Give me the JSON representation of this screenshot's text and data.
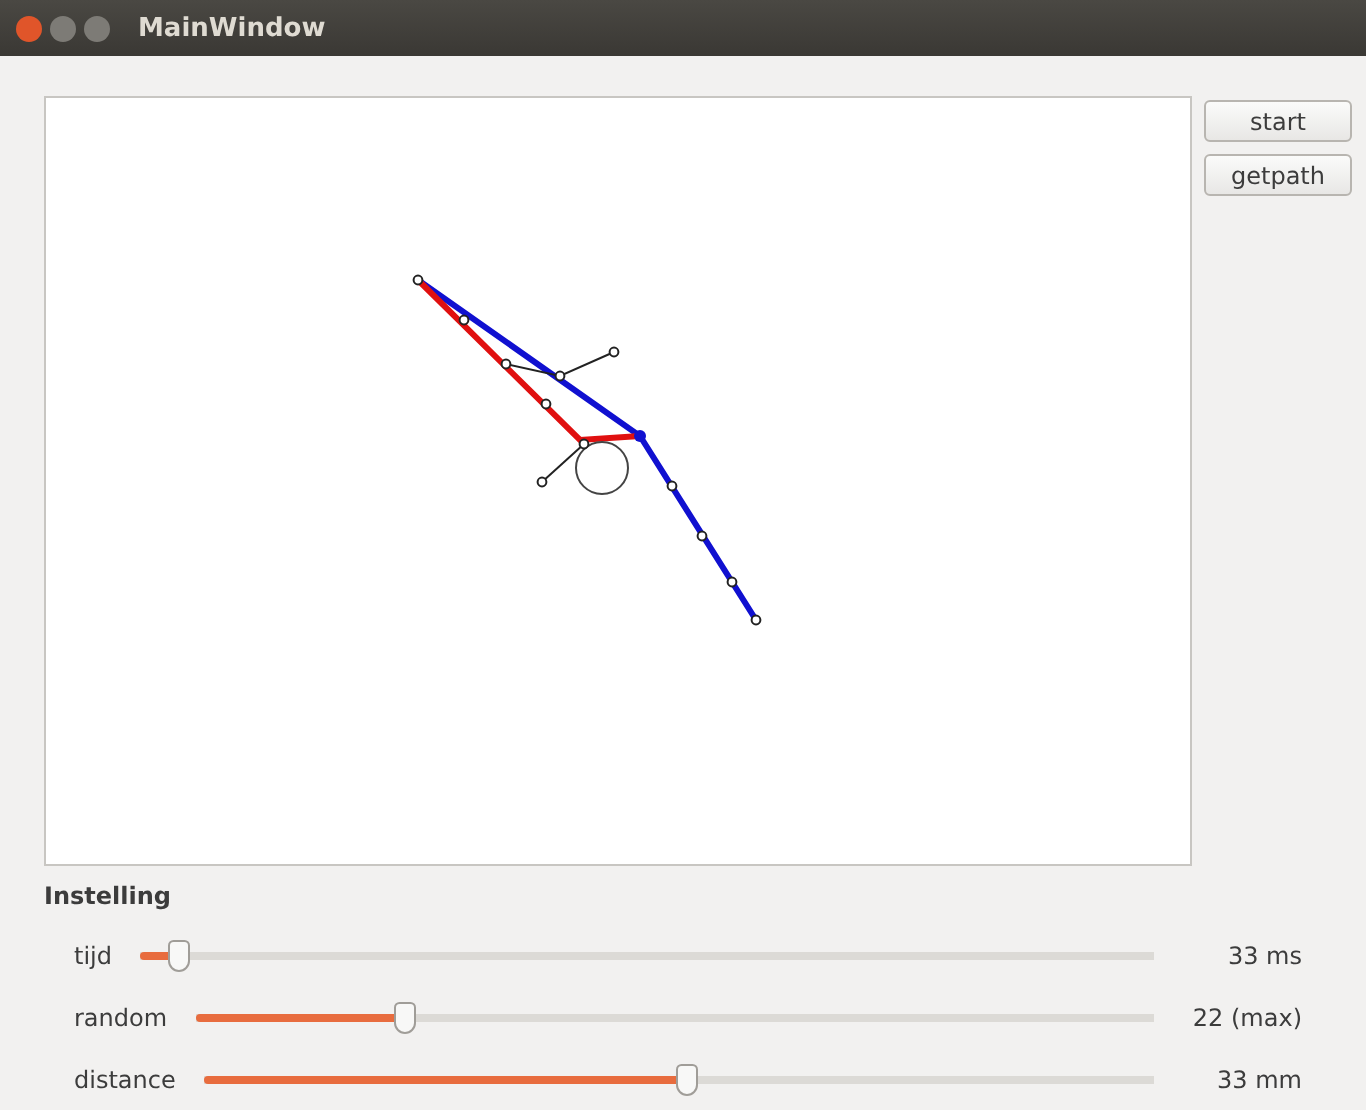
{
  "window": {
    "title": "MainWindow"
  },
  "buttons": [
    {
      "label": "start"
    },
    {
      "label": "getpath"
    }
  ],
  "settings": {
    "title": "Instelling",
    "sliders": [
      {
        "label": "tijd",
        "level": 0.04,
        "reading": "33 ms"
      },
      {
        "label": "random",
        "level": 0.22,
        "reading": "22 (max)"
      },
      {
        "label": "distance",
        "level": 0.51,
        "reading": "33 mm"
      }
    ]
  }
}
